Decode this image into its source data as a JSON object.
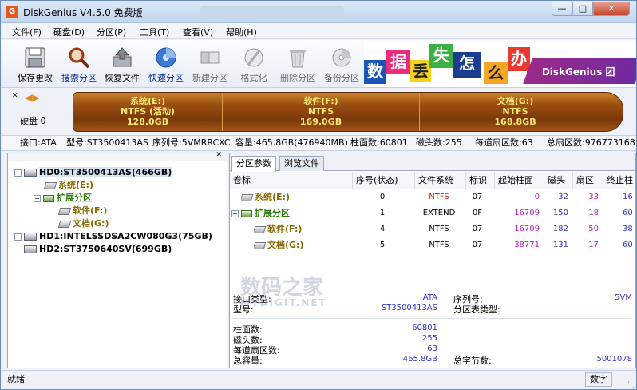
{
  "window": {
    "title": "DiskGenius V4.5.0 免费版",
    "app_icon": "G"
  },
  "menu": [
    "文件(F)",
    "硬盘(D)",
    "分区(P)",
    "工具(T)",
    "查看(V)",
    "帮助(H)"
  ],
  "toolbar": [
    {
      "label": "保存更改",
      "icon": "save-icon"
    },
    {
      "label": "搜索分区",
      "icon": "search-partition-icon"
    },
    {
      "label": "恢复文件",
      "icon": "recover-files-icon"
    },
    {
      "label": "快速分区",
      "icon": "quick-partition-icon"
    },
    {
      "label": "新建分区",
      "icon": "new-partition-icon"
    },
    {
      "label": "格式化",
      "icon": "format-icon"
    },
    {
      "label": "删除分区",
      "icon": "delete-partition-icon"
    },
    {
      "label": "备份分区",
      "icon": "backup-partition-icon"
    }
  ],
  "banner": {
    "chars": [
      "数",
      "据",
      "丢",
      "失",
      "怎",
      "么",
      "办",
      "!"
    ],
    "brand": "DiskGenius 团"
  },
  "diskmap": {
    "disk_label": "硬盘 0",
    "partitions": [
      {
        "name": "系统(E:)",
        "fs": "NTFS (活动)",
        "size": "128.0GB"
      },
      {
        "name": "软件(F:)",
        "fs": "NTFS",
        "size": "169.0GB"
      },
      {
        "name": "文档(G:)",
        "fs": "NTFS",
        "size": "168.8GB"
      }
    ]
  },
  "infobar": [
    "接口:ATA",
    "型号:ST3500413AS",
    "序列号:5VMRRCXC",
    "容量:465.8GB(476940MB)",
    "柱面数:60801",
    "磁头数:255",
    "每道扇区数:63",
    "总扇区数:976773168"
  ],
  "tree": [
    {
      "label": "HD0:ST3500413AS(466GB)",
      "type": "disk"
    },
    {
      "label": "系统(E:)",
      "type": "part"
    },
    {
      "label": "扩展分区",
      "type": "ext"
    },
    {
      "label": "软件(F:)",
      "type": "part"
    },
    {
      "label": "文档(G:)",
      "type": "part"
    },
    {
      "label": "HD1:INTELSSDSA2CW080G3(75GB)",
      "type": "disk"
    },
    {
      "label": "HD2:ST3750640SV(699GB)",
      "type": "disk"
    }
  ],
  "tabs": [
    "分区参数",
    "浏览文件"
  ],
  "table": {
    "columns": [
      "卷标",
      "序号(状态)",
      "文件系统",
      "标识",
      "起始柱面",
      "磁头",
      "扇区",
      "终止柱"
    ],
    "rows": [
      {
        "label": "系统(E:)",
        "index": "0",
        "fs": "NTFS",
        "id": "07",
        "cyl": "0",
        "head": "32",
        "sector": "33",
        "end": "16"
      },
      {
        "label": "扩展分区",
        "index": "1",
        "fs": "EXTEND",
        "id": "0F",
        "cyl": "16709",
        "head": "150",
        "sector": "18",
        "end": "60"
      },
      {
        "label": "软件(F:)",
        "index": "4",
        "fs": "NTFS",
        "id": "07",
        "cyl": "16709",
        "head": "182",
        "sector": "50",
        "end": "38"
      },
      {
        "label": "文档(G:)",
        "index": "5",
        "fs": "NTFS",
        "id": "07",
        "cyl": "38771",
        "head": "131",
        "sector": "17",
        "end": "60"
      }
    ]
  },
  "details": {
    "iface_label": "接口类型:",
    "iface": "ATA",
    "model_label": "型号:",
    "model": "ST3500413AS",
    "serial_label": "序列号:",
    "serial": "5VM",
    "pttype_label": "分区表类型:",
    "cyl_label": "柱面数:",
    "cyl": "60801",
    "heads_label": "磁头数:",
    "heads": "255",
    "spt_label": "每道扇区数:",
    "spt": "63",
    "cap_label": "总容量:",
    "cap": "465.8GB",
    "bytes_label": "总字节数:",
    "bytes": "5001078"
  },
  "watermark": {
    "main": "数码之家",
    "sub": "MYDIGIT.NET"
  },
  "status": {
    "left": "就绪",
    "numlock": "数字"
  }
}
